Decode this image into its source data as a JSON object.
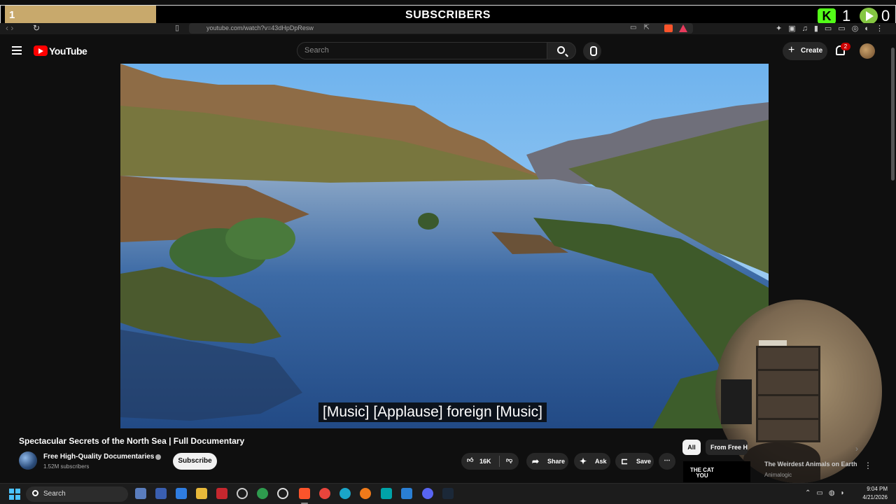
{
  "overlay": {
    "subscriber_count": "1",
    "title": "SUBSCRIBERS",
    "kick_count": "1",
    "rumble_count": "0",
    "progress_fraction": 0.17
  },
  "browser": {
    "url": "youtube.com/watch?v=43dHpDpResw"
  },
  "header": {
    "logo_text": "YouTube",
    "search_placeholder": "Search",
    "create_label": "Create",
    "notification_count": "2"
  },
  "video": {
    "caption": "[Music] [Applause] foreign [Music]",
    "title": "Spectacular Secrets of the North Sea | Full Documentary"
  },
  "channel": {
    "name": "Free High-Quality Documentaries",
    "subscribers": "1.52M subscribers",
    "subscribe_label": "Subscribe"
  },
  "actions": {
    "like_count": "16K",
    "share_label": "Share",
    "ask_label": "Ask",
    "save_label": "Save",
    "more_label": "⋯"
  },
  "chips": {
    "all": "All",
    "from": "From Free H"
  },
  "recommendation": {
    "thumb_text": "THE CAT YOU",
    "title": "The Weirdest Animals on Earth",
    "channel": "Animalogic"
  },
  "taskbar": {
    "search_label": "Search",
    "time": "9:04 PM",
    "date": "4/21/2026"
  },
  "colors": {
    "youtube_red": "#ff0000",
    "kick_green": "#53fc18",
    "rumble_green": "#85c742",
    "overlay_progress": "#c8a96c"
  }
}
